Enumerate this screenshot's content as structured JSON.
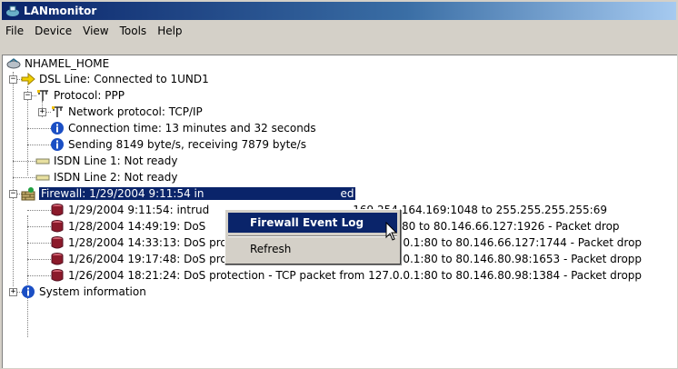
{
  "window": {
    "title": "LANmonitor"
  },
  "menu": [
    "File",
    "Device",
    "View",
    "Tools",
    "Help"
  ],
  "tree": {
    "root": "NHAMEL_HOME",
    "dsl": "DSL Line: Connected to 1UND1",
    "protocol": "Protocol: PPP",
    "network_protocol": "Network protocol: TCP/IP",
    "connection_time": "Connection time: 13 minutes and 32 seconds",
    "throughput": "Sending 8149 byte/s, receiving 7879 byte/s",
    "isdn1": "ISDN Line 1: Not ready",
    "isdn2": "ISDN Line 2: Not ready",
    "firewall_part1": "Firewall: 1/29/2004 9:11:54 in",
    "firewall_part2": "ed",
    "events": [
      {
        "left": "1/29/2004 9:11:54: intrud",
        "right": "169.254.164.169:1048 to 255.255.255.255:69"
      },
      {
        "left": "1/28/2004 14:49:19: DoS",
        "right": "27.0.0.1:80 to 80.146.66.127:1926 - Packet drop"
      },
      {
        "left": "1/28/2004 14:33:13: DoS protection - TCP packet from 127.0.0.1:80 to 80.146.66.127:1744 - Packet drop",
        "right": ""
      },
      {
        "left": "1/26/2004 19:17:48: DoS protection - TCP packet from 127.0.0.1:80 to 80.146.80.98:1653 - Packet dropp",
        "right": ""
      },
      {
        "left": "1/26/2004 18:21:24: DoS protection - TCP packet from 127.0.0.1:80 to 80.146.80.98:1384 - Packet dropp",
        "right": ""
      }
    ],
    "system_info": "System information"
  },
  "context_menu": {
    "items": [
      "Firewall Event Log",
      "Refresh"
    ]
  },
  "colors": {
    "selection": "#0a246a",
    "titlebar": "#0a246a",
    "info_icon": "#1b4fc4",
    "event_icon": "#8b1a2b"
  }
}
